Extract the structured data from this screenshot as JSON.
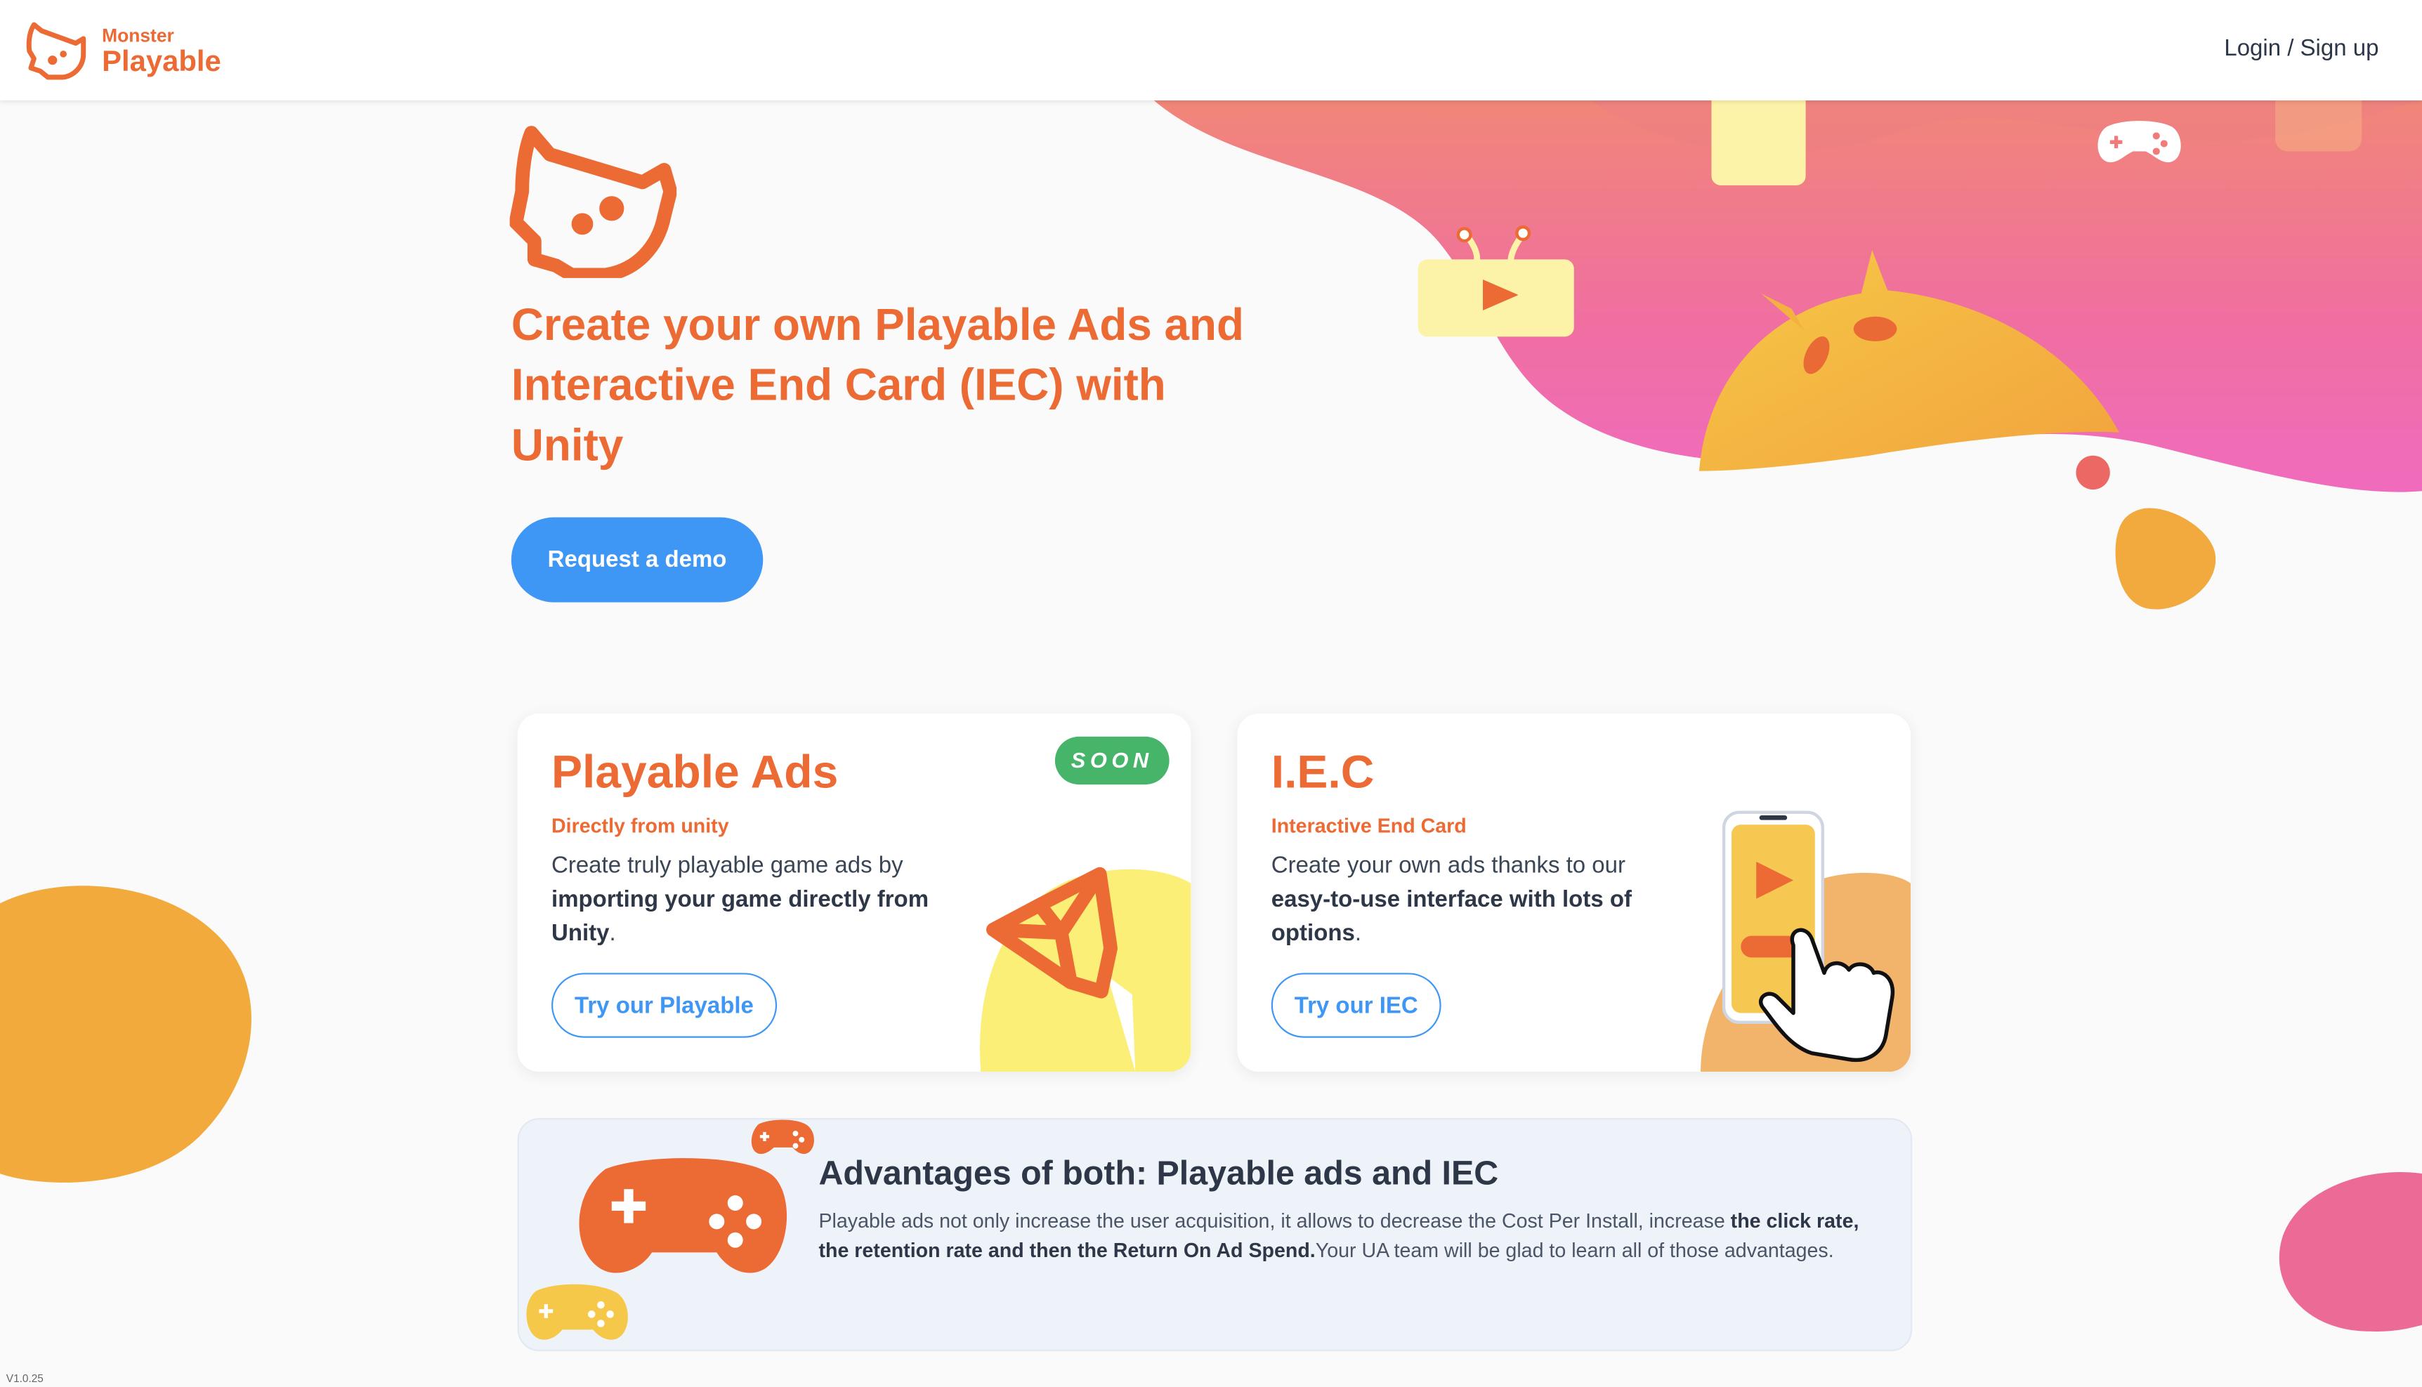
{
  "header": {
    "logo_small": "Monster",
    "logo_big": "Playable",
    "login_label": "Login / Sign up"
  },
  "hero": {
    "title": "Create your own Playable Ads and Interactive End Card (IEC) with Unity",
    "cta_label": "Request a demo"
  },
  "cards": {
    "playable": {
      "title": "Playable Ads",
      "badge": "SOON",
      "subtitle": "Directly from unity",
      "desc_pre": "Create truly playable game ads by ",
      "desc_bold": "importing your game directly from Unity",
      "desc_post": ".",
      "button_label": "Try our Playable"
    },
    "iec": {
      "title": "I.E.C",
      "subtitle": "Interactive End Card",
      "desc_pre": "Create your own ads thanks to our ",
      "desc_bold": "easy-to-use interface with lots of options",
      "desc_post": ".",
      "button_label": "Try our IEC"
    }
  },
  "advantages": {
    "title": "Advantages of both: Playable ads and IEC",
    "text_pre": "Playable ads not only increase the user acquisition, it allows to decrease the Cost Per Install, increase ",
    "text_bold": "the click rate, the retention rate and then the Return On Ad Spend.",
    "text_post": "Your UA team will be glad to learn all of those advantages."
  },
  "version": "V1.0.25",
  "colors": {
    "brand_orange": "#ec6a33",
    "primary_blue": "#3f97f5",
    "soon_green": "#46b56a",
    "text_dark": "#2d3748"
  },
  "icons": {
    "logo": "monster-play-icon",
    "unity": "unity-logo-icon",
    "gamepad": "gamepad-icon",
    "phone": "phone-icon",
    "hand": "pointing-hand-icon"
  }
}
